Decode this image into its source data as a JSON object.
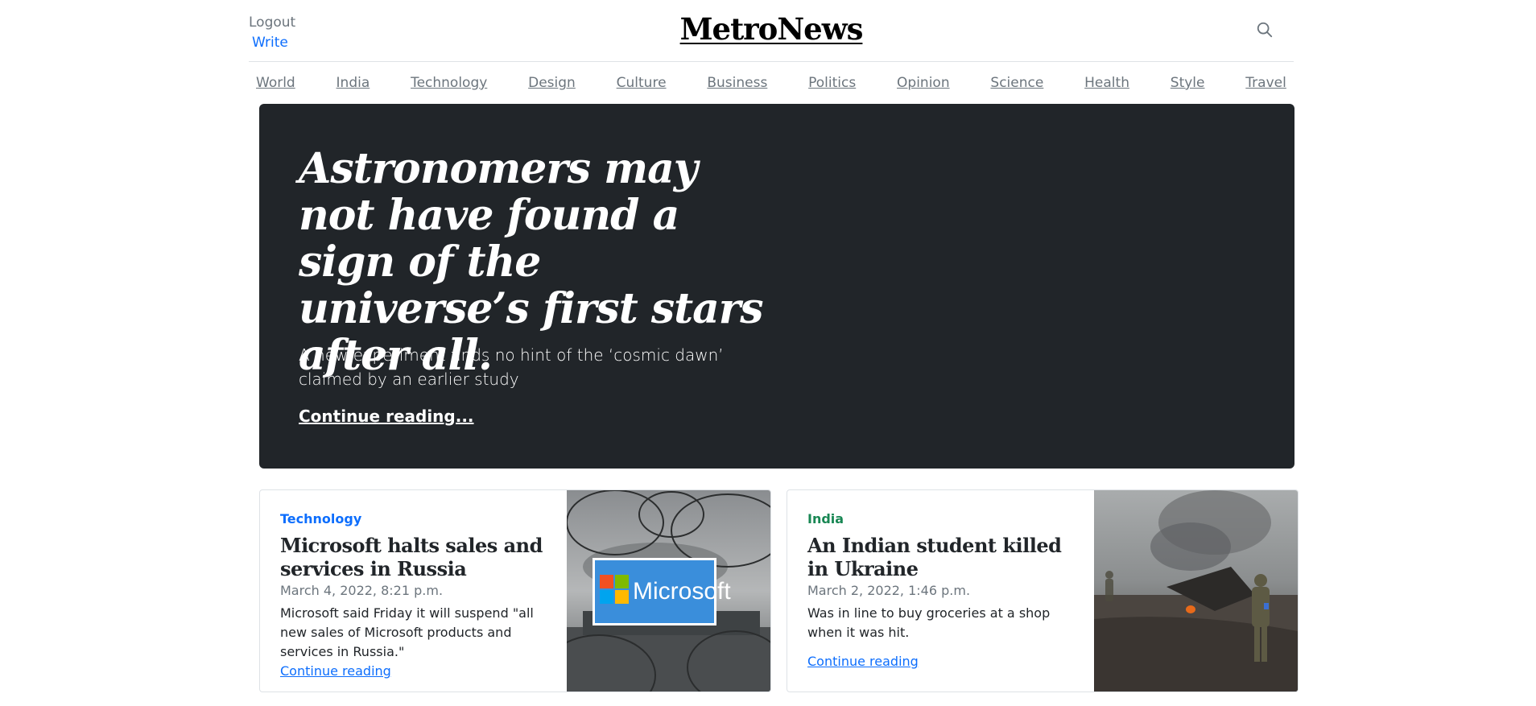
{
  "header": {
    "logout_label": "Logout",
    "write_label": "Write",
    "brand": "MetroNews",
    "search_icon": "search-icon"
  },
  "nav": {
    "items": [
      "World",
      "India",
      "Technology",
      "Design",
      "Culture",
      "Business",
      "Politics",
      "Opinion",
      "Science",
      "Health",
      "Style",
      "Travel"
    ]
  },
  "hero": {
    "title": "Astronomers may not have found a sign of the universe’s first stars after all.",
    "lead": "A new experiment finds no hint of the ‘cosmic dawn’ claimed by an earlier study",
    "link": "Continue reading...",
    "bg_color": "#212529"
  },
  "cards": [
    {
      "category": "Technology",
      "category_color": "#0d6efd",
      "title": "Microsoft halts sales and services in Russia",
      "date": "March 4, 2022, 8:21 p.m.",
      "text": "Microsoft said Friday it will suspend \"all new sales of Microsoft products and services in Russia.\"",
      "link": "Continue reading",
      "image_text": "Microsoft"
    },
    {
      "category": "India",
      "category_color": "#198754",
      "title": "An Indian student killed in Ukraine",
      "date": "March 2, 2022, 1:46 p.m.",
      "text": "Was in line to buy groceries at a shop when it was hit.",
      "link": "Continue reading"
    }
  ]
}
